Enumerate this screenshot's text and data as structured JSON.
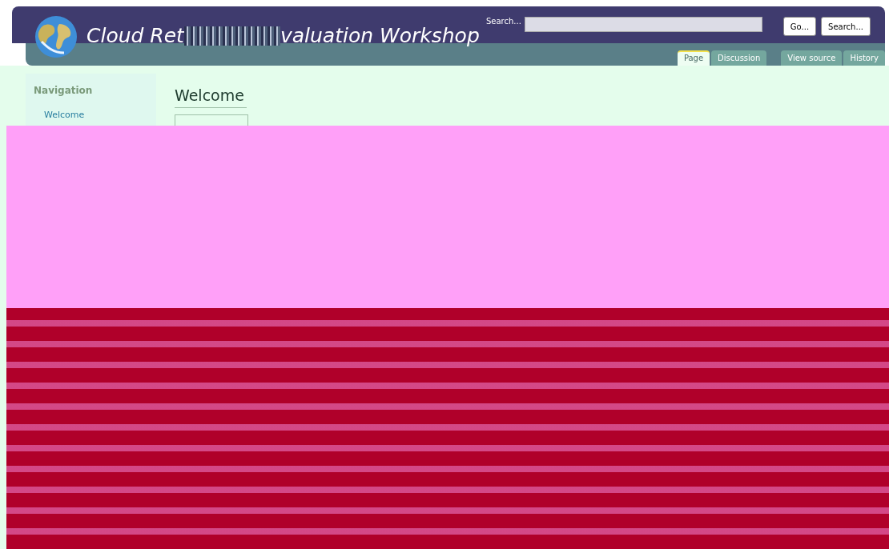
{
  "header": {
    "title_start": "Cloud Ret",
    "title_end": "valuation Workshop",
    "search_label": "Search...",
    "buttons": [
      "Go...",
      "Search..."
    ]
  },
  "tabs": [
    {
      "label": "Page",
      "selected": true
    },
    {
      "label": "Discussion",
      "selected": false
    },
    {
      "label": "View source",
      "selected": false
    },
    {
      "label": "History",
      "selected": false
    }
  ],
  "sidebar": {
    "heading": "Navigation",
    "items": [
      "Welcome"
    ]
  },
  "content": {
    "heading": "Welcome"
  }
}
